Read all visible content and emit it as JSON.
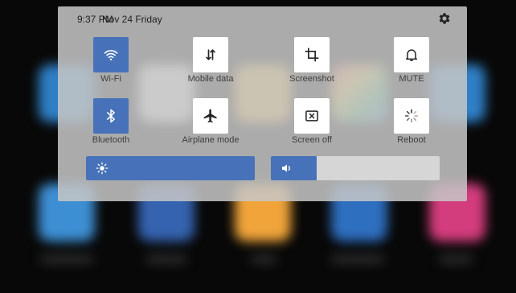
{
  "status": {
    "time": "9:37 PM",
    "date": "Nov 24 Friday"
  },
  "icons": {
    "settings": "gear-icon"
  },
  "toggles": [
    {
      "id": "wifi",
      "label": "Wi-Fi",
      "icon": "wifi-icon",
      "active": true
    },
    {
      "id": "mobile-data",
      "label": "Mobile data",
      "icon": "mobile-data-icon",
      "active": false
    },
    {
      "id": "screenshot",
      "label": "Screenshot",
      "icon": "crop-icon",
      "active": false
    },
    {
      "id": "mute",
      "label": "MUTE",
      "icon": "bell-icon",
      "active": false
    },
    {
      "id": "bluetooth",
      "label": "Bluetooth",
      "icon": "bluetooth-icon",
      "active": true
    },
    {
      "id": "airplane",
      "label": "Airplane mode",
      "icon": "airplane-icon",
      "active": false
    },
    {
      "id": "screen-off",
      "label": "Screen off",
      "icon": "screen-off-icon",
      "active": false
    },
    {
      "id": "reboot",
      "label": "Reboot",
      "icon": "reboot-icon",
      "active": false
    }
  ],
  "sliders": {
    "brightness": {
      "icon": "brightness-icon",
      "level": 1.0
    },
    "volume": {
      "icon": "volume-icon",
      "level": 0.27
    }
  },
  "colors": {
    "accent": "#4772b9",
    "panel": "#c6c6c6",
    "tile": "#ffffff"
  }
}
